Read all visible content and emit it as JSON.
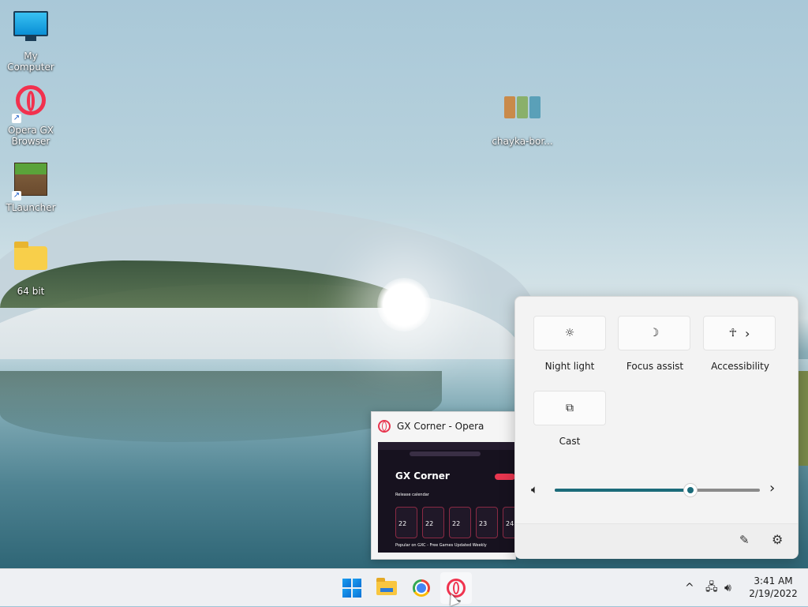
{
  "desktop": {
    "icons": [
      {
        "label": "My Computer",
        "icon": "monitor-icon"
      },
      {
        "label": "Opera GX Browser",
        "icon": "opera-gx-icon"
      },
      {
        "label": "TLauncher",
        "icon": "minecraft-grass-block-icon"
      },
      {
        "label": "64 bit",
        "icon": "folder-icon"
      },
      {
        "label": "chayka-bor...",
        "icon": "image-file-icon"
      }
    ]
  },
  "quick_settings": {
    "tiles": [
      {
        "label": "Night light",
        "icon": "brightness-icon"
      },
      {
        "label": "Focus assist",
        "icon": "moon-icon"
      },
      {
        "label": "Accessibility",
        "icon": "accessibility-icon",
        "chevron": "›"
      },
      {
        "label": "Cast",
        "icon": "cast-icon"
      }
    ],
    "volume": {
      "level": 0.66,
      "icon": "speaker-icon",
      "chevron": "›"
    },
    "footer": {
      "edit_icon": "pencil-icon",
      "settings_icon": "gear-icon"
    }
  },
  "preview": {
    "title": "GX Corner - Opera",
    "thumbnail": {
      "heading": "GX Corner",
      "subheading": "Release calendar",
      "cards": [
        "22",
        "22",
        "22",
        "23",
        "24"
      ],
      "footer": "Popular on GXC - Free Games Updated Weekly"
    }
  },
  "taskbar": {
    "apps": [
      {
        "name": "Start",
        "icon": "windows-start-icon"
      },
      {
        "name": "File Explorer",
        "icon": "file-explorer-icon"
      },
      {
        "name": "Google Chrome",
        "icon": "chrome-icon"
      },
      {
        "name": "Opera GX",
        "icon": "opera-icon"
      }
    ],
    "tray": {
      "chevron": "^",
      "network_icon": "network-icon",
      "volume_icon": "speaker-icon"
    },
    "clock": {
      "time": "3:41 AM",
      "date": "2/19/2022"
    }
  },
  "colors": {
    "accent": "#1b6b7a",
    "opera_red": "#e8364f"
  }
}
